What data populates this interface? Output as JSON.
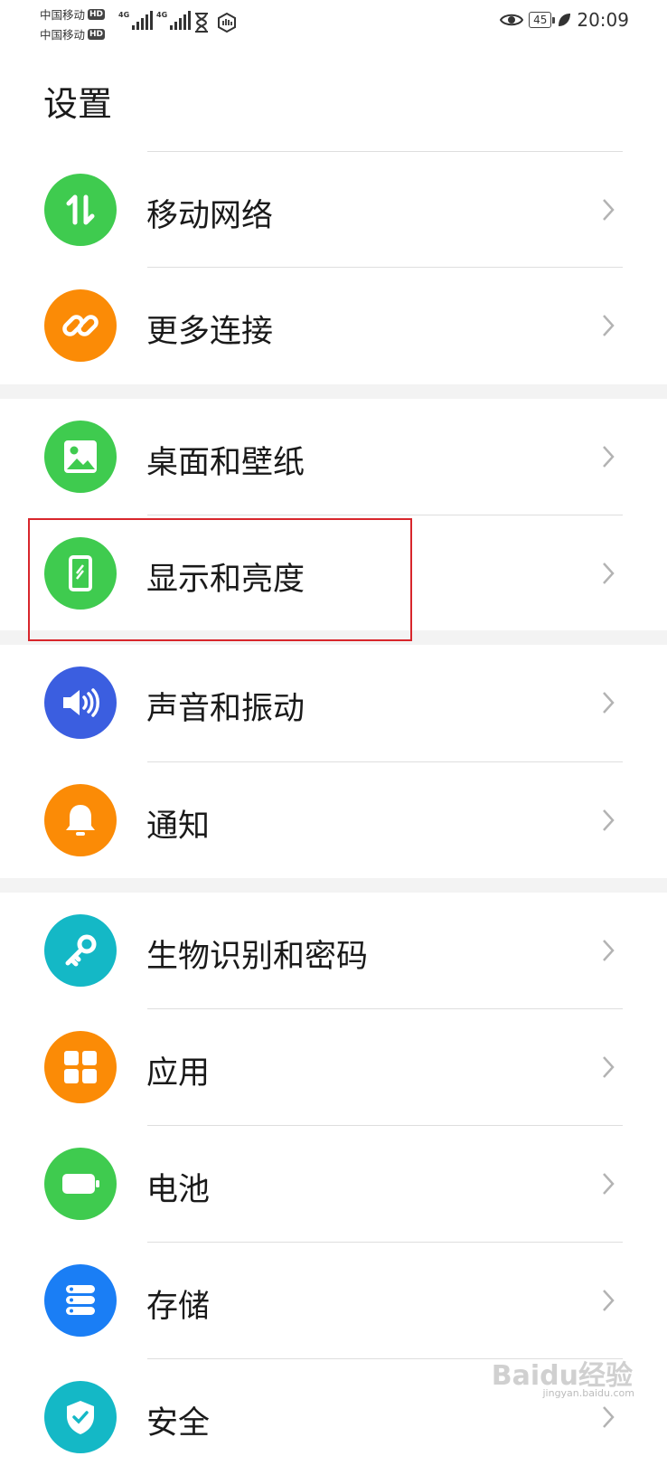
{
  "status_bar": {
    "carrier1": "中国移动",
    "carrier2": "中国移动",
    "hd": "HD",
    "net1": "4G",
    "net2": "4G",
    "battery": "45",
    "time": "20:09"
  },
  "page": {
    "title": "设置"
  },
  "settings": [
    {
      "label": "移动网络",
      "icon": "arrows-updown-icon",
      "color": "#3fcb4f"
    },
    {
      "label": "更多连接",
      "icon": "link-icon",
      "color": "#fb8b06"
    },
    {
      "label": "桌面和壁纸",
      "icon": "image-icon",
      "color": "#3fcb4f"
    },
    {
      "label": "显示和亮度",
      "icon": "phone-brightness-icon",
      "color": "#3fcb4f"
    },
    {
      "label": "声音和振动",
      "icon": "speaker-icon",
      "color": "#3b5ee0"
    },
    {
      "label": "通知",
      "icon": "bell-icon",
      "color": "#fb8b06"
    },
    {
      "label": "生物识别和密码",
      "icon": "key-icon",
      "color": "#14b8c6"
    },
    {
      "label": "应用",
      "icon": "apps-grid-icon",
      "color": "#fb8b06"
    },
    {
      "label": "电池",
      "icon": "battery-icon",
      "color": "#3fcb4f"
    },
    {
      "label": "存储",
      "icon": "storage-icon",
      "color": "#1a7ef5"
    },
    {
      "label": "安全",
      "icon": "shield-icon",
      "color": "#14b8c6"
    }
  ],
  "watermark": {
    "text": "Baidu经验",
    "sub": "jingyan.baidu.com"
  }
}
